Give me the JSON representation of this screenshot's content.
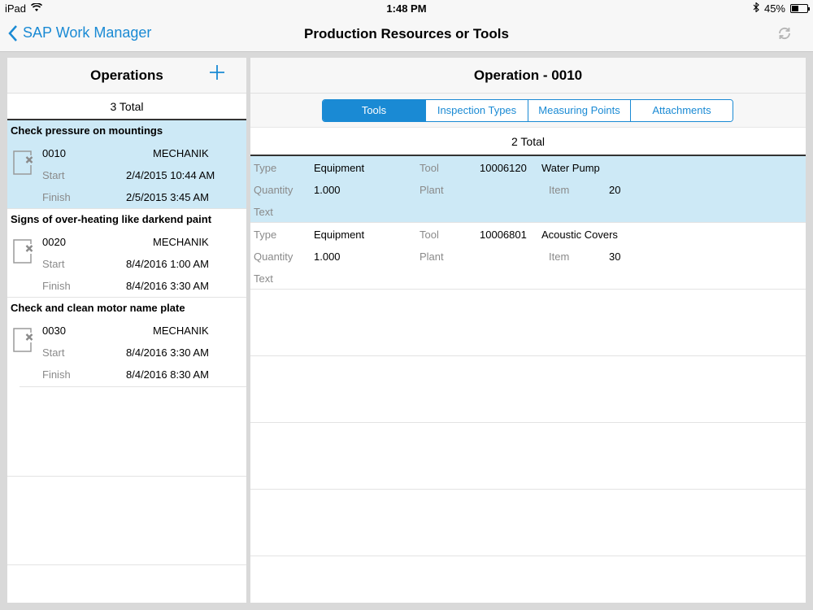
{
  "status": {
    "device": "iPad",
    "time": "1:48 PM",
    "battery": "45%",
    "battery_level": 0.45
  },
  "nav": {
    "back_label": "SAP Work Manager",
    "title": "Production Resources or Tools"
  },
  "left": {
    "title": "Operations",
    "total": "3 Total",
    "operations": [
      {
        "title": "Check pressure on mountings",
        "number": "0010",
        "work_center": "MECHANIK",
        "start_label": "Start",
        "start": "2/4/2015 10:44 AM",
        "finish_label": "Finish",
        "finish": "2/5/2015 3:45 AM"
      },
      {
        "title": "Signs of over-heating like darkend paint",
        "number": "0020",
        "work_center": "MECHANIK",
        "start_label": "Start",
        "start": "8/4/2016 1:00 AM",
        "finish_label": "Finish",
        "finish": "8/4/2016 3:30 AM"
      },
      {
        "title": "Check and clean motor name plate",
        "number": "0030",
        "work_center": "MECHANIK",
        "start_label": "Start",
        "start": "8/4/2016 3:30 AM",
        "finish_label": "Finish",
        "finish": "8/4/2016 8:30 AM"
      }
    ]
  },
  "right": {
    "title": "Operation - 0010",
    "tabs": [
      "Tools",
      "Inspection Types",
      "Measuring Points",
      "Attachments"
    ],
    "total": "2 Total",
    "labels": {
      "type": "Type",
      "tool": "Tool",
      "quantity": "Quantity",
      "plant": "Plant",
      "item": "Item",
      "text": "Text"
    },
    "tools": [
      {
        "type": "Equipment",
        "tool_number": "10006120",
        "tool_name": "Water Pump",
        "quantity": "1.000",
        "plant": "",
        "item": "20",
        "text": ""
      },
      {
        "type": "Equipment",
        "tool_number": "10006801",
        "tool_name": "Acoustic Covers",
        "quantity": "1.000",
        "plant": "",
        "item": "30",
        "text": ""
      }
    ]
  },
  "colors": {
    "accent": "#1a8ad4",
    "selected_row": "#cde9f6"
  }
}
